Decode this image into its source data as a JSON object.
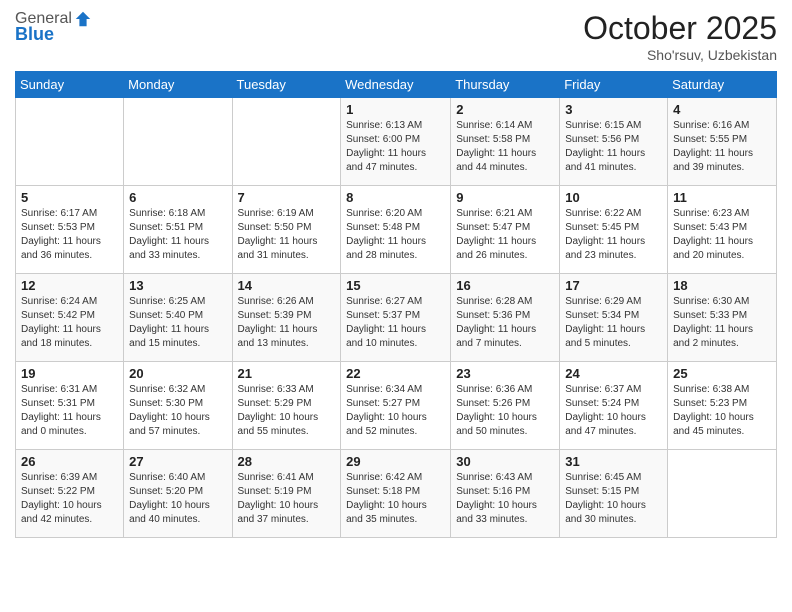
{
  "header": {
    "logo_line1": "General",
    "logo_line2": "Blue",
    "month": "October 2025",
    "location": "Sho'rsuv, Uzbekistan"
  },
  "weekdays": [
    "Sunday",
    "Monday",
    "Tuesday",
    "Wednesday",
    "Thursday",
    "Friday",
    "Saturday"
  ],
  "weeks": [
    [
      {
        "day": "",
        "info": ""
      },
      {
        "day": "",
        "info": ""
      },
      {
        "day": "",
        "info": ""
      },
      {
        "day": "1",
        "info": "Sunrise: 6:13 AM\nSunset: 6:00 PM\nDaylight: 11 hours and 47 minutes."
      },
      {
        "day": "2",
        "info": "Sunrise: 6:14 AM\nSunset: 5:58 PM\nDaylight: 11 hours and 44 minutes."
      },
      {
        "day": "3",
        "info": "Sunrise: 6:15 AM\nSunset: 5:56 PM\nDaylight: 11 hours and 41 minutes."
      },
      {
        "day": "4",
        "info": "Sunrise: 6:16 AM\nSunset: 5:55 PM\nDaylight: 11 hours and 39 minutes."
      }
    ],
    [
      {
        "day": "5",
        "info": "Sunrise: 6:17 AM\nSunset: 5:53 PM\nDaylight: 11 hours and 36 minutes."
      },
      {
        "day": "6",
        "info": "Sunrise: 6:18 AM\nSunset: 5:51 PM\nDaylight: 11 hours and 33 minutes."
      },
      {
        "day": "7",
        "info": "Sunrise: 6:19 AM\nSunset: 5:50 PM\nDaylight: 11 hours and 31 minutes."
      },
      {
        "day": "8",
        "info": "Sunrise: 6:20 AM\nSunset: 5:48 PM\nDaylight: 11 hours and 28 minutes."
      },
      {
        "day": "9",
        "info": "Sunrise: 6:21 AM\nSunset: 5:47 PM\nDaylight: 11 hours and 26 minutes."
      },
      {
        "day": "10",
        "info": "Sunrise: 6:22 AM\nSunset: 5:45 PM\nDaylight: 11 hours and 23 minutes."
      },
      {
        "day": "11",
        "info": "Sunrise: 6:23 AM\nSunset: 5:43 PM\nDaylight: 11 hours and 20 minutes."
      }
    ],
    [
      {
        "day": "12",
        "info": "Sunrise: 6:24 AM\nSunset: 5:42 PM\nDaylight: 11 hours and 18 minutes."
      },
      {
        "day": "13",
        "info": "Sunrise: 6:25 AM\nSunset: 5:40 PM\nDaylight: 11 hours and 15 minutes."
      },
      {
        "day": "14",
        "info": "Sunrise: 6:26 AM\nSunset: 5:39 PM\nDaylight: 11 hours and 13 minutes."
      },
      {
        "day": "15",
        "info": "Sunrise: 6:27 AM\nSunset: 5:37 PM\nDaylight: 11 hours and 10 minutes."
      },
      {
        "day": "16",
        "info": "Sunrise: 6:28 AM\nSunset: 5:36 PM\nDaylight: 11 hours and 7 minutes."
      },
      {
        "day": "17",
        "info": "Sunrise: 6:29 AM\nSunset: 5:34 PM\nDaylight: 11 hours and 5 minutes."
      },
      {
        "day": "18",
        "info": "Sunrise: 6:30 AM\nSunset: 5:33 PM\nDaylight: 11 hours and 2 minutes."
      }
    ],
    [
      {
        "day": "19",
        "info": "Sunrise: 6:31 AM\nSunset: 5:31 PM\nDaylight: 11 hours and 0 minutes."
      },
      {
        "day": "20",
        "info": "Sunrise: 6:32 AM\nSunset: 5:30 PM\nDaylight: 10 hours and 57 minutes."
      },
      {
        "day": "21",
        "info": "Sunrise: 6:33 AM\nSunset: 5:29 PM\nDaylight: 10 hours and 55 minutes."
      },
      {
        "day": "22",
        "info": "Sunrise: 6:34 AM\nSunset: 5:27 PM\nDaylight: 10 hours and 52 minutes."
      },
      {
        "day": "23",
        "info": "Sunrise: 6:36 AM\nSunset: 5:26 PM\nDaylight: 10 hours and 50 minutes."
      },
      {
        "day": "24",
        "info": "Sunrise: 6:37 AM\nSunset: 5:24 PM\nDaylight: 10 hours and 47 minutes."
      },
      {
        "day": "25",
        "info": "Sunrise: 6:38 AM\nSunset: 5:23 PM\nDaylight: 10 hours and 45 minutes."
      }
    ],
    [
      {
        "day": "26",
        "info": "Sunrise: 6:39 AM\nSunset: 5:22 PM\nDaylight: 10 hours and 42 minutes."
      },
      {
        "day": "27",
        "info": "Sunrise: 6:40 AM\nSunset: 5:20 PM\nDaylight: 10 hours and 40 minutes."
      },
      {
        "day": "28",
        "info": "Sunrise: 6:41 AM\nSunset: 5:19 PM\nDaylight: 10 hours and 37 minutes."
      },
      {
        "day": "29",
        "info": "Sunrise: 6:42 AM\nSunset: 5:18 PM\nDaylight: 10 hours and 35 minutes."
      },
      {
        "day": "30",
        "info": "Sunrise: 6:43 AM\nSunset: 5:16 PM\nDaylight: 10 hours and 33 minutes."
      },
      {
        "day": "31",
        "info": "Sunrise: 6:45 AM\nSunset: 5:15 PM\nDaylight: 10 hours and 30 minutes."
      },
      {
        "day": "",
        "info": ""
      }
    ]
  ]
}
